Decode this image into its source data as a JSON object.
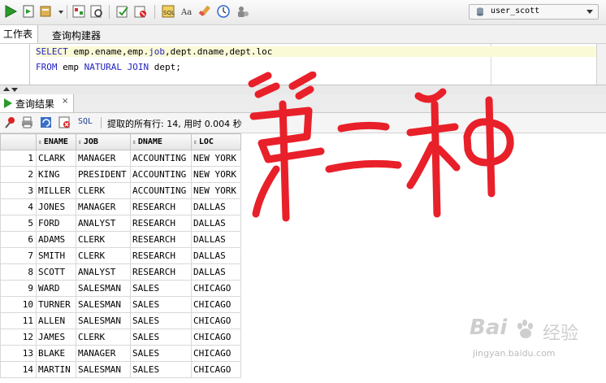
{
  "toolbar": {
    "connection": "user_scott",
    "icons": [
      "run-statement-icon",
      "run-script-icon",
      "commit-dropdown-icon",
      "explain-plan-icon",
      "autotrace-icon",
      "commit-icon",
      "rollback-icon",
      "sql-tuning-icon",
      "uppercase-icon",
      "clear-icon",
      "history-icon",
      "unshared-icon"
    ]
  },
  "subtabs": {
    "worksheet": "工作表",
    "query_builder": "查询构建器"
  },
  "editor": {
    "line1": {
      "kw1": "SELECT",
      "rest": " emp.ename,emp.",
      "kw2": "job",
      "rest2": ",dept.dname,dept.loc"
    },
    "line2": {
      "kw1": "FROM",
      "mid": " emp ",
      "kw2": "NATURAL JOIN",
      "rest": " dept;"
    }
  },
  "results": {
    "tab_label": "查询结果",
    "close": "×",
    "sql_label": "SQL",
    "status": "提取的所有行: 14, 用时 0.004 秒"
  },
  "grid": {
    "columns": [
      "ENAME",
      "JOB",
      "DNAME",
      "LOC"
    ],
    "rows": [
      {
        "n": "1",
        "ename": "CLARK",
        "job": "MANAGER",
        "dname": "ACCOUNTING",
        "loc": "NEW YORK"
      },
      {
        "n": "2",
        "ename": "KING",
        "job": "PRESIDENT",
        "dname": "ACCOUNTING",
        "loc": "NEW YORK"
      },
      {
        "n": "3",
        "ename": "MILLER",
        "job": "CLERK",
        "dname": "ACCOUNTING",
        "loc": "NEW YORK"
      },
      {
        "n": "4",
        "ename": "JONES",
        "job": "MANAGER",
        "dname": "RESEARCH",
        "loc": "DALLAS"
      },
      {
        "n": "5",
        "ename": "FORD",
        "job": "ANALYST",
        "dname": "RESEARCH",
        "loc": "DALLAS"
      },
      {
        "n": "6",
        "ename": "ADAMS",
        "job": "CLERK",
        "dname": "RESEARCH",
        "loc": "DALLAS"
      },
      {
        "n": "7",
        "ename": "SMITH",
        "job": "CLERK",
        "dname": "RESEARCH",
        "loc": "DALLAS"
      },
      {
        "n": "8",
        "ename": "SCOTT",
        "job": "ANALYST",
        "dname": "RESEARCH",
        "loc": "DALLAS"
      },
      {
        "n": "9",
        "ename": "WARD",
        "job": "SALESMAN",
        "dname": "SALES",
        "loc": "CHICAGO"
      },
      {
        "n": "10",
        "ename": "TURNER",
        "job": "SALESMAN",
        "dname": "SALES",
        "loc": "CHICAGO"
      },
      {
        "n": "11",
        "ename": "ALLEN",
        "job": "SALESMAN",
        "dname": "SALES",
        "loc": "CHICAGO"
      },
      {
        "n": "12",
        "ename": "JAMES",
        "job": "CLERK",
        "dname": "SALES",
        "loc": "CHICAGO"
      },
      {
        "n": "13",
        "ename": "BLAKE",
        "job": "MANAGER",
        "dname": "SALES",
        "loc": "CHICAGO"
      },
      {
        "n": "14",
        "ename": "MARTIN",
        "job": "SALESMAN",
        "dname": "SALES",
        "loc": "CHICAGO"
      }
    ]
  },
  "annotation": {
    "handwritten_text": "第二种",
    "color": "#e8202a"
  },
  "watermark": {
    "logo": "Bai",
    "text": "经验",
    "url": "jingyan.baidu.com"
  },
  "colors": {
    "keyword": "#1f1fbf",
    "current_line": "#fbfad7",
    "run_green": "#2a9a2a"
  }
}
